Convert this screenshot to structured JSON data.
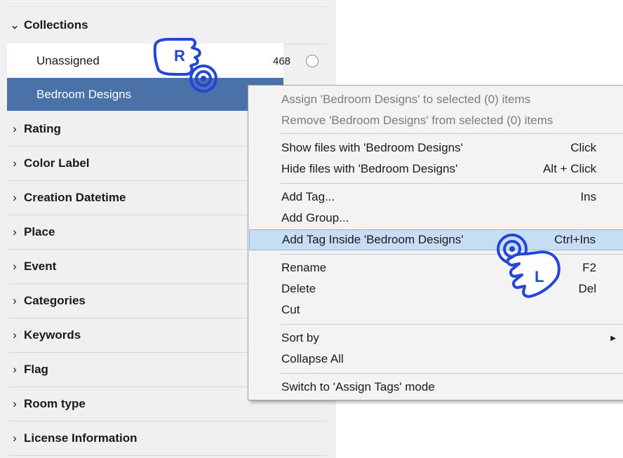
{
  "sidebar": {
    "collections": {
      "label": "Collections",
      "expanded_icon": "chevron-down-icon",
      "items": [
        {
          "label": "Unassigned",
          "count": "468"
        },
        {
          "label": "Bedroom Designs",
          "selected": true
        }
      ]
    },
    "sections": [
      {
        "label": "Rating"
      },
      {
        "label": "Color Label"
      },
      {
        "label": "Creation Datetime"
      },
      {
        "label": "Place"
      },
      {
        "label": "Event"
      },
      {
        "label": "Categories"
      },
      {
        "label": "Keywords"
      },
      {
        "label": "Flag"
      },
      {
        "label": "Room type"
      },
      {
        "label": "License Information"
      }
    ]
  },
  "context_menu": {
    "items": [
      {
        "label": "Assign 'Bedroom Designs' to selected (0) items",
        "disabled": true
      },
      {
        "label": "Remove 'Bedroom Designs' from selected (0) items",
        "disabled": true
      },
      {
        "label": "Show files with 'Bedroom Designs'",
        "shortcut": "Click"
      },
      {
        "label": "Hide files with 'Bedroom Designs'",
        "shortcut": "Alt + Click"
      },
      {
        "label": "Add Tag...",
        "shortcut": "Ins"
      },
      {
        "label": "Add Group..."
      },
      {
        "label": "Add Tag Inside 'Bedroom Designs'",
        "shortcut": "Ctrl+Ins",
        "highlighted": true
      },
      {
        "label": "Rename",
        "shortcut": "F2"
      },
      {
        "label": "Delete",
        "shortcut": "Del"
      },
      {
        "label": "Cut"
      },
      {
        "label": "Sort by",
        "submenu_icon": "submenu-arrow-icon"
      },
      {
        "label": "Collapse All"
      },
      {
        "label": "Switch to 'Assign Tags' mode"
      }
    ]
  },
  "hints": {
    "right_click": "R",
    "left_click": "L"
  },
  "colors": {
    "selection": "#4a72a8",
    "menu_highlight": "#c7ddf4",
    "hint_blue": "#2346d8"
  }
}
